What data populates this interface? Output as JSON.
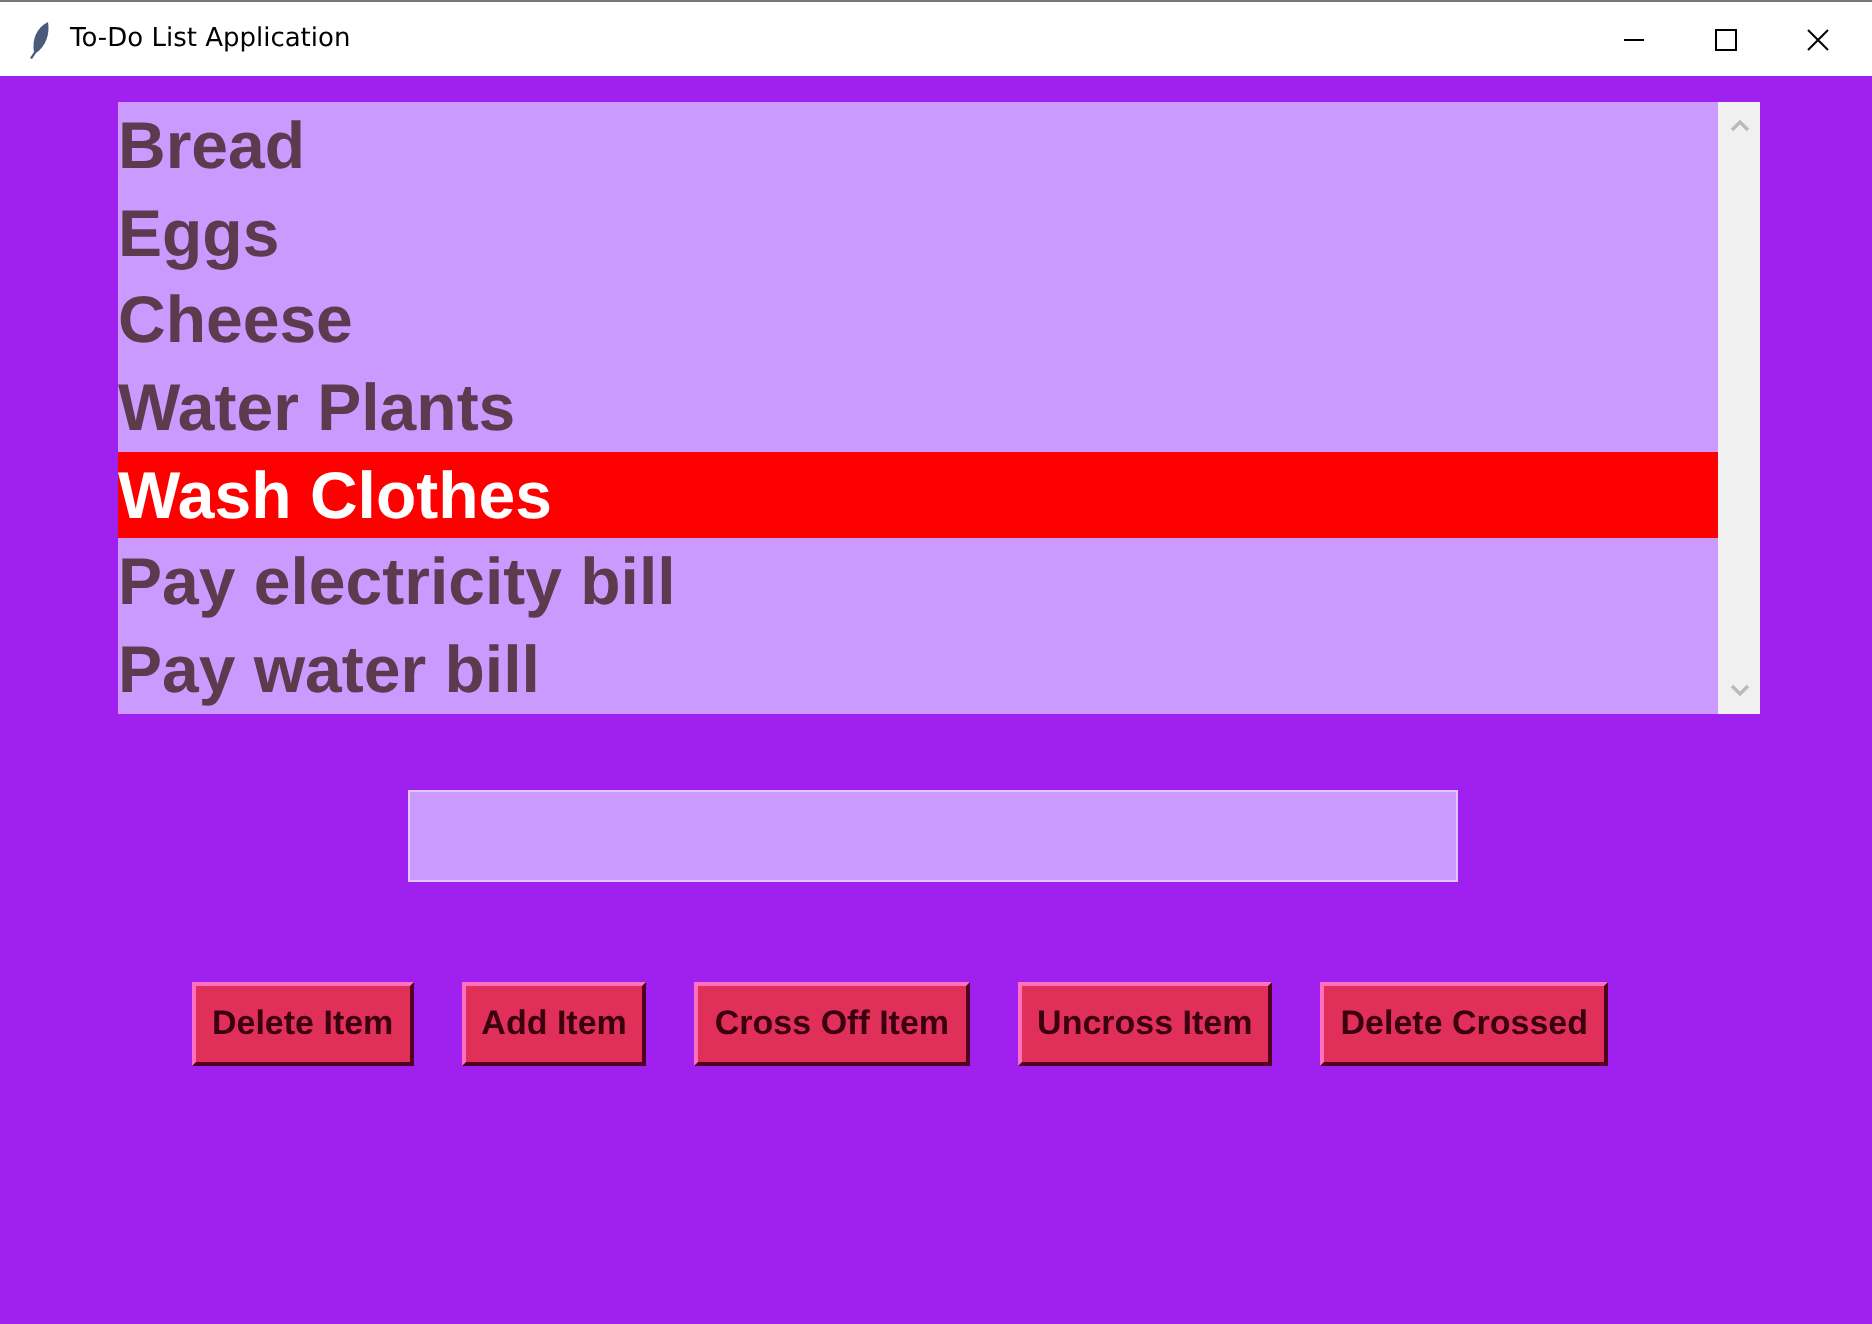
{
  "window": {
    "title": "To-Do List Application"
  },
  "items": [
    {
      "text": "Bread",
      "selected": false
    },
    {
      "text": "Eggs",
      "selected": false
    },
    {
      "text": "Cheese",
      "selected": false
    },
    {
      "text": "Water Plants",
      "selected": false
    },
    {
      "text": "Wash Clothes",
      "selected": true
    },
    {
      "text": "Pay electricity bill",
      "selected": false
    },
    {
      "text": "Pay water bill",
      "selected": false
    }
  ],
  "buttons": [
    "Delete Item",
    "Add Item",
    "Cross Off Item",
    "Uncross Item",
    "Delete Crossed"
  ]
}
